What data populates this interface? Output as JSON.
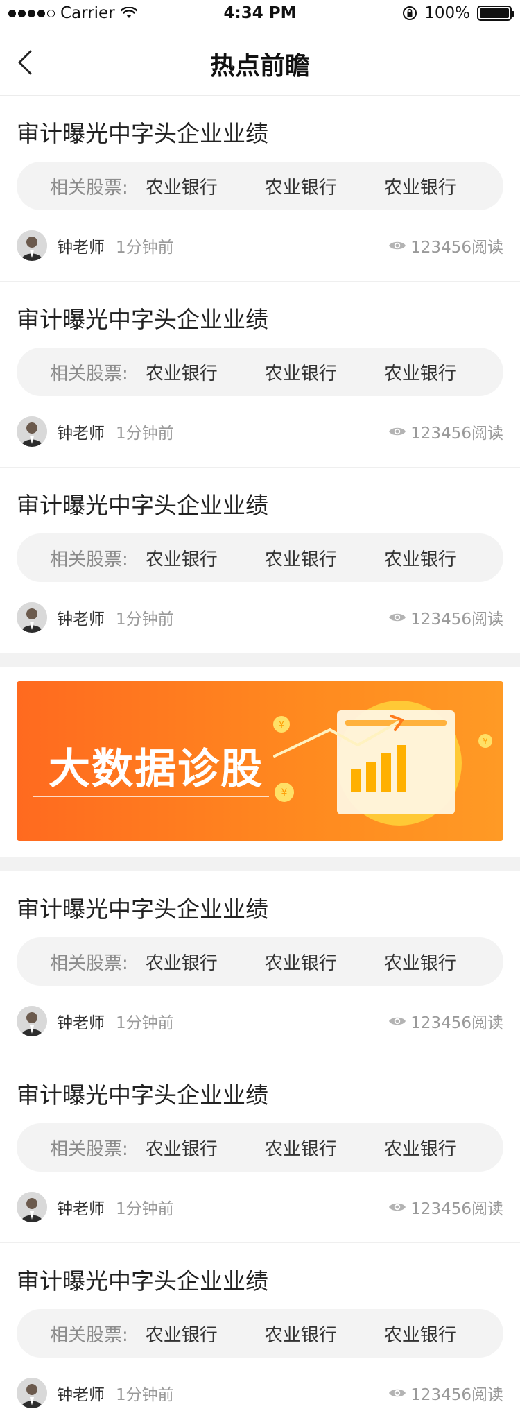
{
  "status": {
    "carrier": "Carrier",
    "time": "4:34 PM",
    "battery": "100%",
    "battery_level": 1.0
  },
  "nav": {
    "title": "热点前瞻"
  },
  "items_top": [
    {
      "title": "审计曝光中字头企业业绩",
      "stocks_label": "相关股票:",
      "stocks": [
        "农业银行",
        "农业银行",
        "农业银行"
      ],
      "author": "钟老师",
      "time": "1分钟前",
      "views": "123456阅读"
    },
    {
      "title": "审计曝光中字头企业业绩",
      "stocks_label": "相关股票:",
      "stocks": [
        "农业银行",
        "农业银行",
        "农业银行"
      ],
      "author": "钟老师",
      "time": "1分钟前",
      "views": "123456阅读"
    },
    {
      "title": "审计曝光中字头企业业绩",
      "stocks_label": "相关股票:",
      "stocks": [
        "农业银行",
        "农业银行",
        "农业银行"
      ],
      "author": "钟老师",
      "time": "1分钟前",
      "views": "123456阅读"
    }
  ],
  "banner": {
    "text": "大数据诊股",
    "colors": {
      "from": "#ff6a1f",
      "to": "#ff9a25"
    }
  },
  "items_bottom": [
    {
      "title": "审计曝光中字头企业业绩",
      "stocks_label": "相关股票:",
      "stocks": [
        "农业银行",
        "农业银行",
        "农业银行"
      ],
      "author": "钟老师",
      "time": "1分钟前",
      "views": "123456阅读"
    },
    {
      "title": "审计曝光中字头企业业绩",
      "stocks_label": "相关股票:",
      "stocks": [
        "农业银行",
        "农业银行",
        "农业银行"
      ],
      "author": "钟老师",
      "time": "1分钟前",
      "views": "123456阅读"
    },
    {
      "title": "审计曝光中字头企业业绩",
      "stocks_label": "相关股票:",
      "stocks": [
        "农业银行",
        "农业银行",
        "农业银行"
      ],
      "author": "钟老师",
      "time": "1分钟前",
      "views": "123456阅读"
    }
  ],
  "icons": {
    "back": "chevron-left-icon",
    "views": "eye-icon",
    "wifi": "wifi-icon",
    "lock": "rotation-lock-icon"
  }
}
